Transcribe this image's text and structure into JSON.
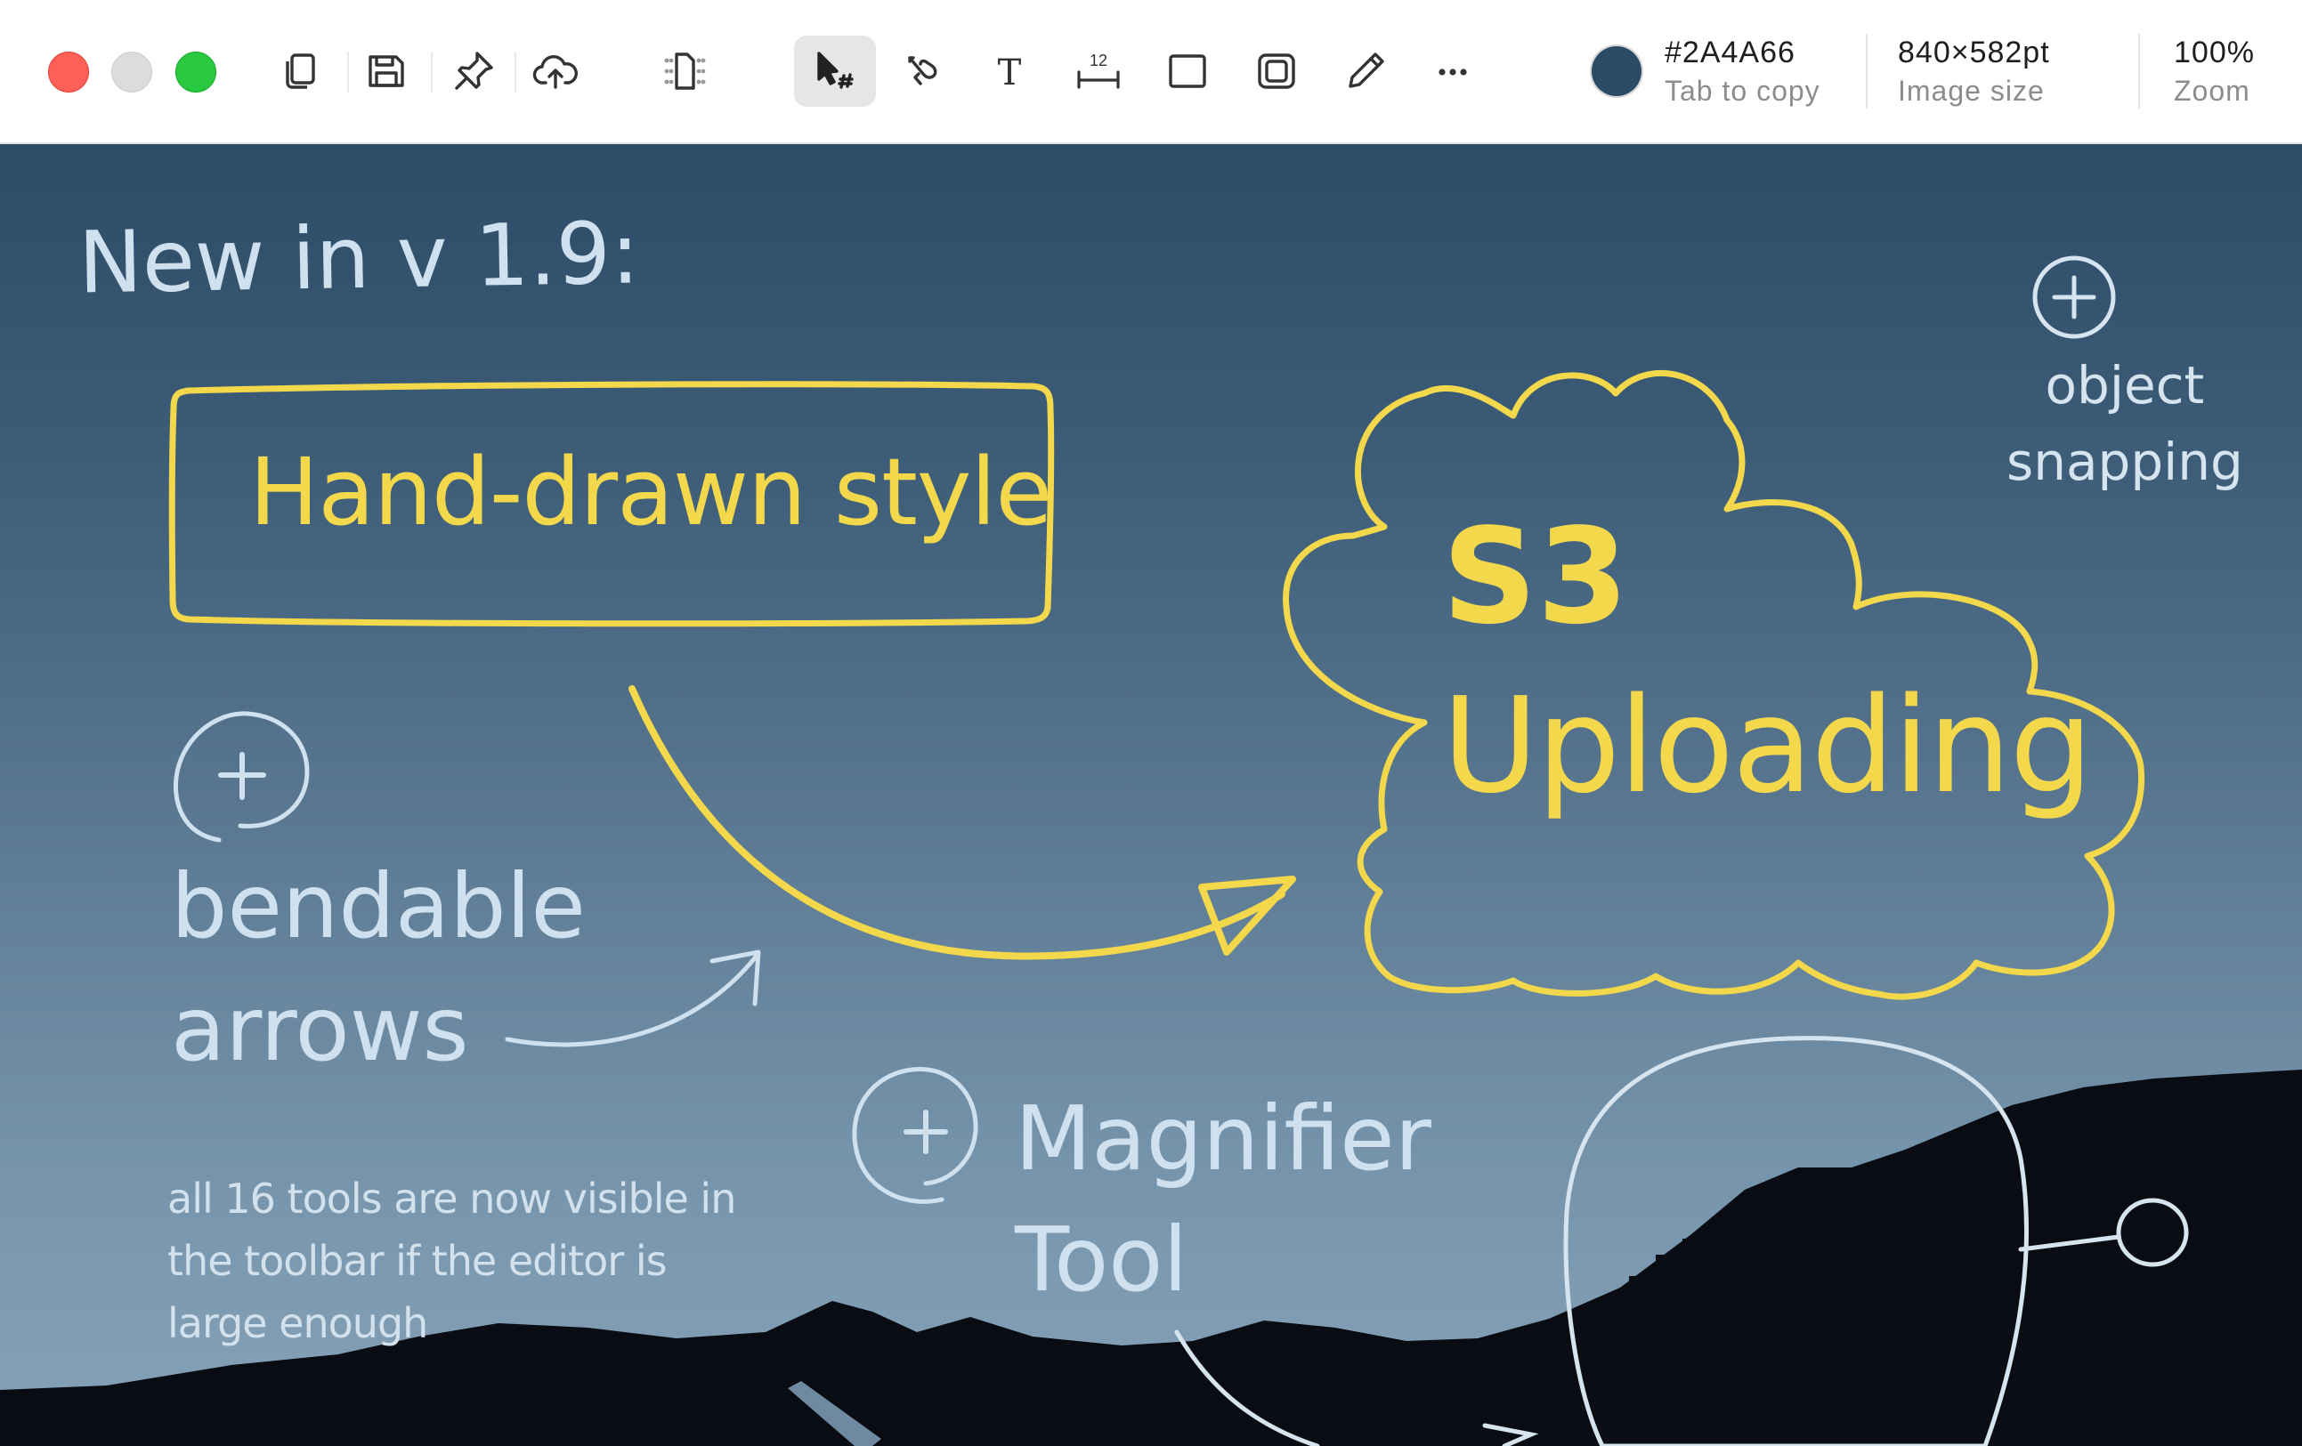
{
  "window": {
    "traffic_lights": [
      "close",
      "minimize-disabled",
      "zoom"
    ]
  },
  "toolbar": {
    "file_tools": [
      {
        "name": "copy-icon"
      },
      {
        "name": "save-icon"
      },
      {
        "name": "pin-icon"
      },
      {
        "name": "cloud-upload-icon"
      },
      {
        "name": "canvas-size-icon"
      }
    ],
    "tools": [
      {
        "name": "select-arrow-icon",
        "active": true
      },
      {
        "name": "hand-arrow-icon"
      },
      {
        "name": "text-icon",
        "glyph": "T"
      },
      {
        "name": "measure-icon",
        "glyph": "12"
      },
      {
        "name": "rectangle-icon"
      },
      {
        "name": "blur-icon"
      },
      {
        "name": "pencil-icon"
      },
      {
        "name": "more-icon",
        "glyph": "···"
      }
    ],
    "color": {
      "value": "#2A4A66",
      "label": "Tab to copy"
    },
    "size": {
      "value": "840×582pt",
      "label": "Image size"
    },
    "zoom": {
      "value": "100%",
      "label": "Zoom"
    }
  },
  "canvas": {
    "title": "New in v 1.9:",
    "hand_drawn": "Hand-drawn style",
    "s3": "S3",
    "uploading": "Uploading",
    "snapping_1": "object",
    "snapping_2": "snapping",
    "bendable_1": "bendable",
    "bendable_2": "arrows",
    "magnifier_1": "Magnifier",
    "magnifier_2": "Tool",
    "note_1": "all 16 tools are now visible in",
    "note_2": "the toolbar if the editor is",
    "note_3": "large enough",
    "colors": {
      "accent": "#F2D84A",
      "chalk": "#CFE0EE",
      "background_top": "#2C4B67",
      "background_bottom": "#86A2B8"
    }
  }
}
